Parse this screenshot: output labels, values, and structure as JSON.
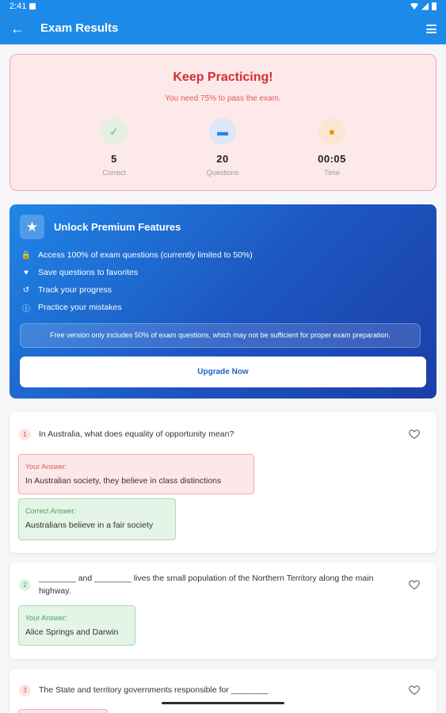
{
  "status_bar": {
    "time": "2:41"
  },
  "app_bar": {
    "title": "Exam Results"
  },
  "result": {
    "heading": "Keep Practicing!",
    "message": "You need 75% to pass the exam.",
    "stats": [
      {
        "value": "5",
        "label": "Correct",
        "icon": "check-icon",
        "icon_glyph": "✓",
        "color": "#66bb6a",
        "bg": "#e3efe0"
      },
      {
        "value": "20",
        "label": "Questions",
        "icon": "chat-icon",
        "icon_glyph": "▬",
        "color": "#1e88e5",
        "bg": "#dde7f7"
      },
      {
        "value": "00:05",
        "label": "Time",
        "icon": "timer-icon",
        "icon_glyph": "●",
        "color": "#fb8c00",
        "bg": "#fbe6d4"
      }
    ]
  },
  "premium": {
    "title": "Unlock Premium Features",
    "features": [
      {
        "icon": "lock-icon",
        "glyph": "🔒",
        "text": "Access 100% of exam questions (currently limited to 50%)"
      },
      {
        "icon": "heart-icon",
        "glyph": "♥",
        "text": "Save questions to favorites"
      },
      {
        "icon": "history-icon",
        "glyph": "↺",
        "text": "Track your progress"
      },
      {
        "icon": "alert-icon",
        "glyph": "ⓘ",
        "text": "Practice your mistakes"
      }
    ],
    "note": "Free version only includes 50% of exam questions, which may not be sufficient for proper exam preparation.",
    "button": "Upgrade Now"
  },
  "questions": [
    {
      "number": "1",
      "status": "wrong",
      "text": "In Australia, what does equality of opportunity mean?",
      "your_answer_label": "Your Answer:",
      "your_answer": "In Australian society, they believe in class distinctions",
      "correct_answer_label": "Correct Answer:",
      "correct_answer": "Australians believe in a fair society"
    },
    {
      "number": "2",
      "status": "right",
      "text": "________ and ________ lives the small population of the Northern Territory along the main highway.",
      "your_answer_label": "Your Answer:",
      "your_answer": "Alice Springs and Darwin"
    },
    {
      "number": "3",
      "status": "wrong",
      "text": "The State and territory governments responsible for ________"
    }
  ],
  "colors": {
    "primary": "#1e8ae8",
    "fail": "#d32f2f",
    "premium_dark": "#1b3fa8"
  }
}
